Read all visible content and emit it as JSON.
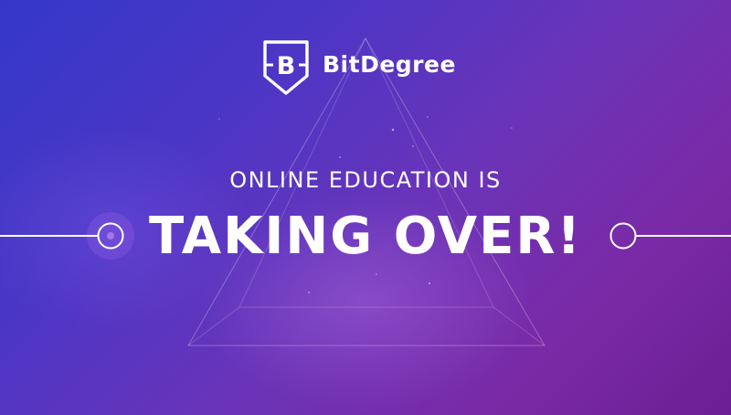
{
  "brand": {
    "name": "BitDegree",
    "logo_icon": "bitdegree-shield-logo-icon"
  },
  "headline": {
    "subtitle": "ONLINE EDUCATION IS",
    "title": "TAKING OVER!"
  },
  "colors": {
    "background_start": "#3438c8",
    "background_end": "#6b1f93",
    "text": "#ffffff",
    "accent_glow": "#be78e6"
  },
  "decorations": {
    "shape": "triangle-outline",
    "connector": "line-with-circle-nodes"
  }
}
